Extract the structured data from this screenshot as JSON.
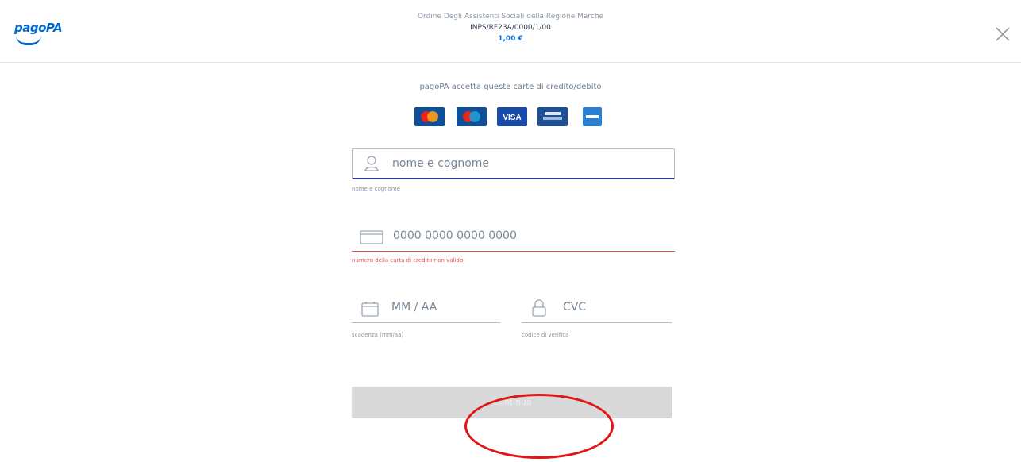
{
  "header": {
    "logo_text": "pagoPA",
    "creditor": "Ordine Degli Assistenti Sociali della Regione Marche",
    "payment_code": "INPS/RF23A/0000/1/00",
    "amount": "1,00 €"
  },
  "accept_text": "pagoPA accetta queste carte di credito/debito",
  "card_brands": [
    "mastercard-icon",
    "maestro-icon",
    "visa-icon",
    "visa-electron-icon",
    "amex-icon"
  ],
  "form": {
    "name": {
      "placeholder": "nome e cognome",
      "help": "nome e cognome"
    },
    "card_number": {
      "placeholder": "0000 0000 0000 0000",
      "help": "numero della carta di credito non valido"
    },
    "expiry": {
      "placeholder": "MM / AA",
      "help": "scadenza (mm/aa)"
    },
    "cvc": {
      "placeholder": "CVC",
      "help": "codice di verifica"
    },
    "submit_label": "Continua"
  },
  "colors": {
    "accent": "#0066cc",
    "error": "#e55454",
    "focus_border": "#2e3a9c",
    "annotation": "#e01616"
  }
}
